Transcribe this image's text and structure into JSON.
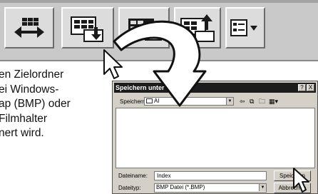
{
  "toolbar": {
    "buttons": [
      {
        "icon": "double-arrow-icon"
      },
      {
        "icon": "save-frames-icon"
      },
      {
        "icon": "save-frames-alt-icon"
      },
      {
        "icon": "load-frames-icon"
      },
      {
        "icon": "view-dropdown-icon"
      }
    ]
  },
  "description": {
    "lines": [
      "en Zielordner",
      "ei Windows-",
      "ap (BMP) oder",
      "Filmhalter",
      "nert wird."
    ]
  },
  "dialog": {
    "title": "Speichern unter",
    "title_buttons": [
      "?",
      "X"
    ],
    "save_in_label": "Speichern",
    "save_in_value": "Al",
    "filename_label": "Dateiname:",
    "filename_value": "Index",
    "filetype_label": "Dateityp:",
    "filetype_value": "BMP Datei (*.BMP)",
    "save_button": "Speichern",
    "cancel_button": "Abbrechen"
  }
}
